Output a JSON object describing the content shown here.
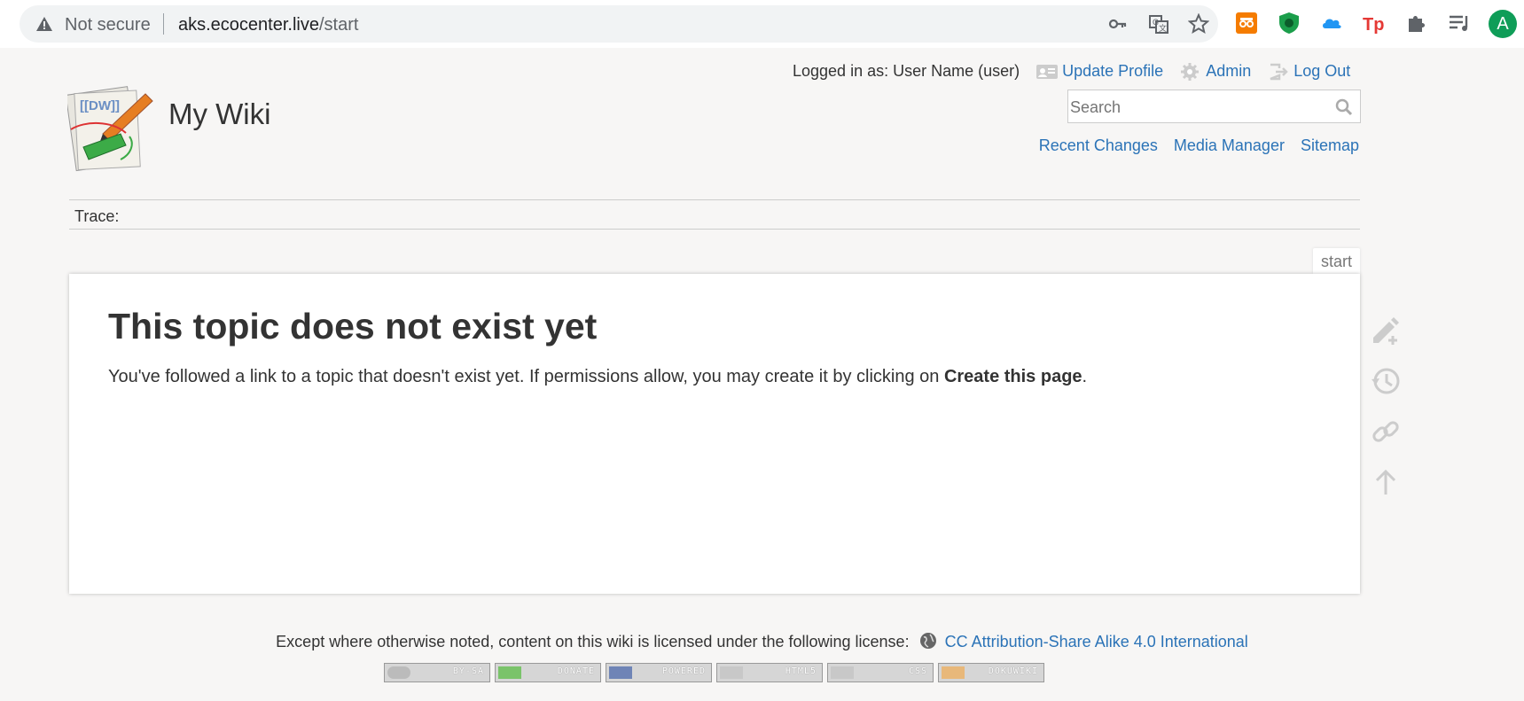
{
  "browser": {
    "security_label": "Not secure",
    "url_host": "aks.ecocenter.live",
    "url_path": "/start",
    "profile_initial": "A"
  },
  "header": {
    "site_title": "My Wiki",
    "logged_in_text": "Logged in as: User Name (user)",
    "user_tools": {
      "update_profile": "Update Profile",
      "admin": "Admin",
      "log_out": "Log Out"
    },
    "search": {
      "placeholder": "Search"
    },
    "site_tools": {
      "recent_changes": "Recent Changes",
      "media_manager": "Media Manager",
      "sitemap": "Sitemap"
    },
    "trace_label": "Trace:"
  },
  "page": {
    "id_tab": "start",
    "heading": "This topic does not exist yet",
    "body_prefix": "You've followed a link to a topic that doesn't exist yet. If permissions allow, you may create it by clicking on ",
    "body_bold": "Create this page",
    "body_suffix": "."
  },
  "footer": {
    "license_text": "Except where otherwise noted, content on this wiki is licensed under the following license:",
    "license_link": "CC Attribution-Share Alike 4.0 International",
    "badges": [
      "BY-SA",
      "DONATE",
      "POWERED",
      "HTML5",
      "CSS",
      "DOKUWIKI"
    ]
  },
  "colors": {
    "link": "#2b73b7",
    "page_bg": "#f7f6f5",
    "text": "#333333"
  }
}
